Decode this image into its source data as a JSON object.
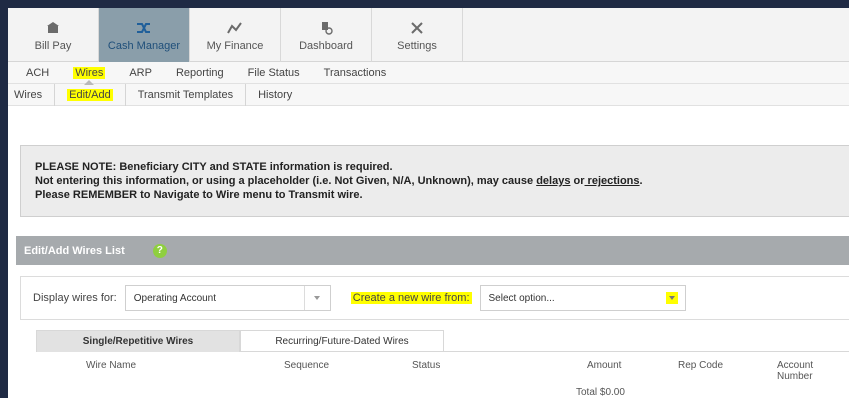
{
  "top_nav": [
    {
      "label": "Bill Pay",
      "icon": "bank-icon"
    },
    {
      "label": "Cash Manager",
      "icon": "shuffle-icon"
    },
    {
      "label": "My Finance",
      "icon": "chart-line-icon"
    },
    {
      "label": "Dashboard",
      "icon": "dashboard-icon"
    },
    {
      "label": "Settings",
      "icon": "tools-icon"
    }
  ],
  "sub_nav": [
    "ACH",
    "Wires",
    "ARP",
    "Reporting",
    "File Status",
    "Transactions"
  ],
  "third_nav": [
    "Wires",
    "Edit/Add",
    "Transmit Templates",
    "History"
  ],
  "notice": {
    "line1": "PLEASE NOTE: Beneficiary CITY and STATE information is required.",
    "line2_a": "Not entering this information, or using a placeholder (i.e. Not Given, N/A, Unknown), may cause ",
    "line2_delays": "delays",
    "line2_or": " or",
    "line2_rejections": " rejections",
    "line2_end": ".",
    "line3": "Please REMEMBER to Navigate to Wire menu to Transmit wire."
  },
  "section": {
    "title": "Edit/Add Wires List",
    "help": "?"
  },
  "filters": {
    "display_label": "Display wires for:",
    "display_value": "Operating Account",
    "create_label": "Create a new wire from:",
    "create_placeholder": "Select option..."
  },
  "tabs": [
    "Single/Repetitive Wires",
    "Recurring/Future-Dated Wires"
  ],
  "table": {
    "columns": [
      "Wire Name",
      "Sequence",
      "Status",
      "Amount",
      "Rep Code",
      "Account Number"
    ],
    "total": "Total $0.00"
  },
  "colors": {
    "active_nav": "#8a9eaa",
    "highlight": "#ffff00",
    "section_header": "#a6aaad",
    "help_icon": "#8fcf3f"
  }
}
